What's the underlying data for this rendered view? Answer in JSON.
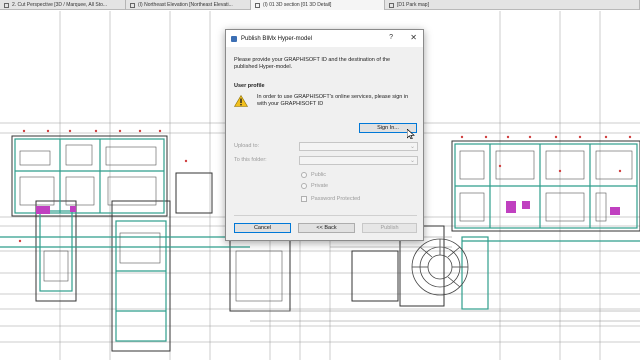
{
  "tabs": [
    {
      "label": "2. Cut Perspective [3D / Marquee, All Sto..."
    },
    {
      "label": "(I) Northeast Elevation [Northeast Elevati..."
    },
    {
      "label": "(I) 01 3D section [01 3D Detail]"
    },
    {
      "label": "[D1 Park map]"
    }
  ],
  "dialog": {
    "title": "Publish BIMx Hyper-model",
    "help_glyph": "?",
    "close_glyph": "✕",
    "intro": "Please provide your GRAPHISOFT ID and the destination of the published Hyper-model.",
    "section_label": "User profile",
    "warning_text": "In order to use GRAPHISOFT's online services, please sign in with your GRAPHISOFT ID",
    "sign_in_label": "Sign In...",
    "upload_label": "Upload to:",
    "folder_label": "To this folder:",
    "public_label": "Public",
    "private_label": "Private",
    "password_label": "Password Protected",
    "cancel_label": "Cancel",
    "back_label": "<< Back",
    "publish_label": "Publish"
  },
  "colors": {
    "accent": "#0078d7",
    "warning": "#f2c01e",
    "plan_green": "#2e9e8c",
    "plan_red": "#d04040",
    "plan_magenta": "#c040c0"
  }
}
